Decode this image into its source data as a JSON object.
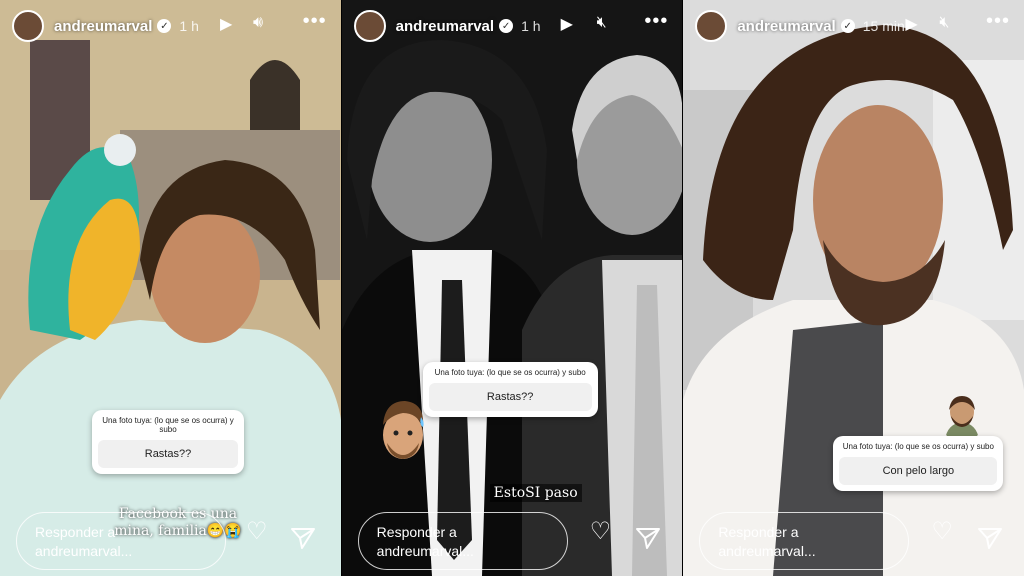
{
  "stories": [
    {
      "username": "andreumarval",
      "time": "1 h",
      "sticker_question": "Una foto tuya: (lo que se os ocurra) y subo",
      "sticker_answer": "Rastas??",
      "caption": "Facebook es una mina, familia😁😭",
      "reply_placeholder": "Responder a andreumarval..."
    },
    {
      "username": "andreumarval",
      "time": "1 h",
      "sticker_question": "Una foto tuya: (lo que se os ocurra) y subo",
      "sticker_answer": "Rastas??",
      "caption": "EstoSI paso",
      "reply_placeholder": "Responder a andreumarval..."
    },
    {
      "username": "andreumarval",
      "time": "15 min",
      "sticker_question": "Una foto tuya: (lo que se os ocurra) y subo",
      "sticker_answer": "Con pelo largo",
      "reply_placeholder": "Responder a andreumarval..."
    }
  ],
  "icons": {
    "play": "play-icon",
    "sound": "speaker-icon",
    "muted": "muted-speaker-icon",
    "more": "more-options-icon",
    "heart": "heart-icon",
    "send": "send-icon",
    "verified": "verified-badge-icon"
  }
}
